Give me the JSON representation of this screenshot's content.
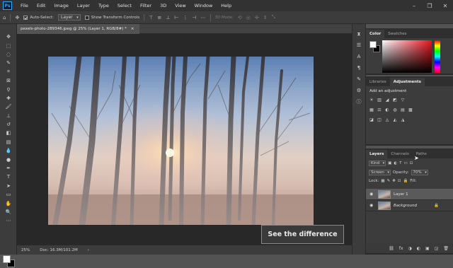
{
  "app": {
    "logo": "Ps"
  },
  "menu": [
    "File",
    "Edit",
    "Image",
    "Layer",
    "Type",
    "Select",
    "Filter",
    "3D",
    "View",
    "Window",
    "Help"
  ],
  "window_controls": [
    "–",
    "❐",
    "✕"
  ],
  "options_bar": {
    "auto_select_label": "Auto-Select:",
    "auto_select_target": "Layer",
    "transform_label": "Show Transform Controls",
    "mode_3d_label": "3D Mode:"
  },
  "document": {
    "tab_title": "pexels-photo-289346.jpeg @ 25% (Layer 1, RGB/8#) *",
    "close": "×",
    "zoom": "25%",
    "doc_info": "Doc: 16.3M/101.2M"
  },
  "overlay_caption": "See the difference",
  "panels": {
    "color_tabs": [
      "Color",
      "Swatches"
    ],
    "adjustment_tabs": [
      "Libraries",
      "Adjustments"
    ],
    "add_adjustment": "Add an adjustment",
    "adjustment_icons_row1": [
      "☀",
      "▥",
      "◢",
      "◩",
      "▽"
    ],
    "adjustment_icons_row2": [
      "▦",
      "⚖",
      "◐",
      "◍",
      "▤",
      "▩"
    ],
    "adjustment_icons_row3": [
      "◪",
      "◫",
      "◬",
      "◭",
      "◮"
    ],
    "layers_tabs": [
      "Layers",
      "Channels",
      "Paths"
    ],
    "kind_label": "Kind",
    "blend_mode": "Screen",
    "opacity_label": "Opacity:",
    "opacity_value": "70%",
    "lock_label": "Lock:",
    "fill_label": "Fill:",
    "layers": [
      {
        "name": "Layer 1",
        "active": true
      },
      {
        "name": "Background",
        "active": false
      }
    ],
    "footer_icons": [
      "fx",
      "◑",
      "◐",
      "▣",
      "◲",
      "🗑"
    ]
  },
  "colors": {
    "fg": "#ffffff",
    "bg": "#000000",
    "accent": "#31a8ff"
  }
}
